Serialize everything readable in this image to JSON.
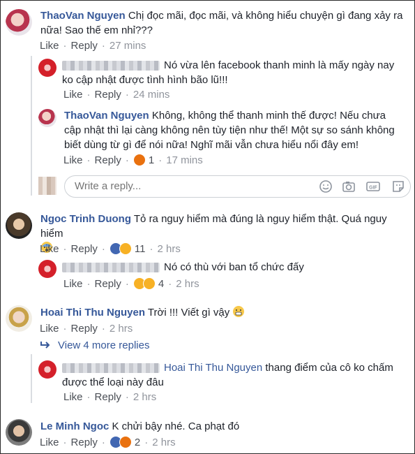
{
  "comments": [
    {
      "name": "ThaoVan Nguyen",
      "text1": "Chị đọc mãi, đọc mãi, và không hiểu chuyện gì đang xảy ra",
      "text2": "nữa! Sao thế em nhỉ???",
      "like": "Like",
      "reply": "Reply",
      "time": "27 mins"
    },
    {
      "text1": "Nó vừa lên facebook thanh minh là mấy ngày nay",
      "text2": "ko cập nhật được tình hình bão lũ!!!",
      "like": "Like",
      "reply": "Reply",
      "time": "24 mins"
    },
    {
      "name": "ThaoVan Nguyen",
      "text1": "Không, không thể thanh minh thế được! Nếu chưa",
      "text2": "cập nhật thì lại càng không nên tùy tiện như thế! Một sự so sánh không",
      "text3": "biết dùng từ gì để nói nữa! Nghĩ mãi vẫn chưa hiểu nổi đây em!",
      "like": "Like",
      "reply": "Reply",
      "count": "1",
      "time": "17 mins"
    },
    {
      "name": "Ngoc Trinh Duong",
      "text1": "Tỏ ra nguy hiểm mà đúng là nguy hiểm thật. Quá nguy hiểm",
      "like": "Like",
      "reply": "Reply",
      "count": "11",
      "time": "2 hrs"
    },
    {
      "text1": "Nó có thù với ban tổ chức đấy",
      "like": "Like",
      "reply": "Reply",
      "count": "4",
      "time": "2 hrs"
    },
    {
      "name": "Hoai Thi Thu Nguyen",
      "text1": "Trời !!! Viết gì vậy",
      "like": "Like",
      "reply": "Reply",
      "time": "2 hrs"
    },
    {
      "mention": "Hoai Thi Thu Nguyen",
      "text1": "thang điểm của cô ko chấm",
      "text2": "được thể loại này đâu",
      "like": "Like",
      "reply": "Reply",
      "time": "2 hrs"
    },
    {
      "name": "Le Minh Ngoc",
      "text1": "K chửi bậy nhé. Ca phạt đó",
      "like": "Like",
      "reply": "Reply",
      "count": "2",
      "time": "2 hrs"
    }
  ],
  "reply_box": {
    "placeholder": "Write a reply..."
  },
  "view_more": "View 4 more replies"
}
